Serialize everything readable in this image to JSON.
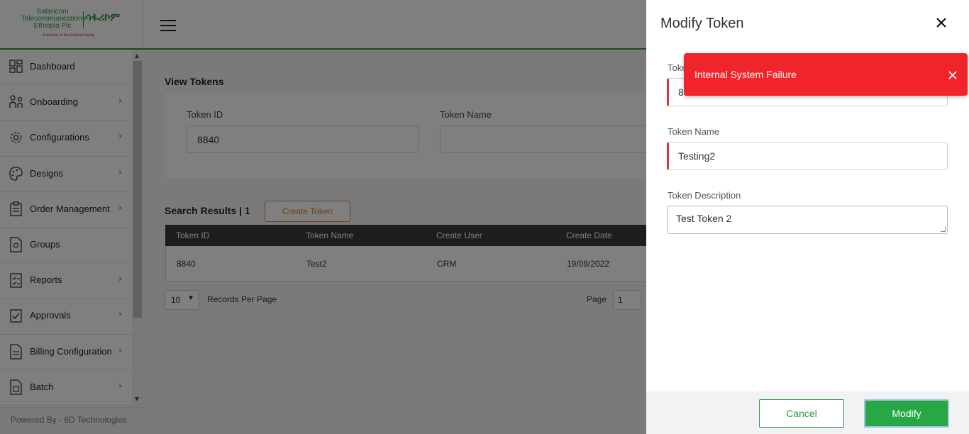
{
  "brand": {
    "name_line1": "Safaricom",
    "name_line2": "Telecommunications",
    "name_line3": "Ethiopia Plc",
    "name_amharic": "ሳፋሪኮም",
    "tagline": "A member of the Vodacom family"
  },
  "sidebar": {
    "items": [
      {
        "label": "Dashboard",
        "icon": "dashboard-icon"
      },
      {
        "label": "Onboarding",
        "icon": "onboarding-icon"
      },
      {
        "label": "Configurations",
        "icon": "gear-icon"
      },
      {
        "label": "Designs",
        "icon": "palette-icon"
      },
      {
        "label": "Order Management",
        "icon": "clipboard-icon"
      },
      {
        "label": "Groups",
        "icon": "document-icon"
      },
      {
        "label": "Reports",
        "icon": "checklist-icon"
      },
      {
        "label": "Approvals",
        "icon": "approval-icon"
      },
      {
        "label": "Billing Configuration",
        "icon": "billing-icon"
      },
      {
        "label": "Batch",
        "icon": "batch-icon"
      }
    ],
    "footer": "Powered By - 6D Technologies"
  },
  "main": {
    "page_title": "View Tokens",
    "filter": {
      "token_id_label": "Token ID",
      "token_id_value": "8840",
      "token_name_label": "Token Name",
      "token_name_value": ""
    },
    "results_title": "Search Results | 1",
    "create_button": "Create Token",
    "table": {
      "headers": [
        "Token ID",
        "Token Name",
        "Create User",
        "Create Date"
      ],
      "rows": [
        [
          "8840",
          "Test2",
          "CRM",
          "19/09/2022"
        ]
      ]
    },
    "pager": {
      "per_page": "10",
      "records_label": "Records Per Page",
      "page_label": "Page",
      "page_value": "1"
    }
  },
  "drawer": {
    "title": "Modify Token",
    "token_id_label": "Token ID",
    "token_id_value": "8822",
    "token_name_label": "Token Name",
    "token_name_value": "Testing2",
    "token_desc_label": "Token Description",
    "token_desc_value": "Test Token 2",
    "cancel": "Cancel",
    "modify": "Modify"
  },
  "toast": {
    "message": "Internal System Failure"
  },
  "colors": {
    "brand_green": "#2d9a3e",
    "button_green": "#28a745",
    "error_red": "#f0242a",
    "accent_orange": "#e67e22"
  }
}
